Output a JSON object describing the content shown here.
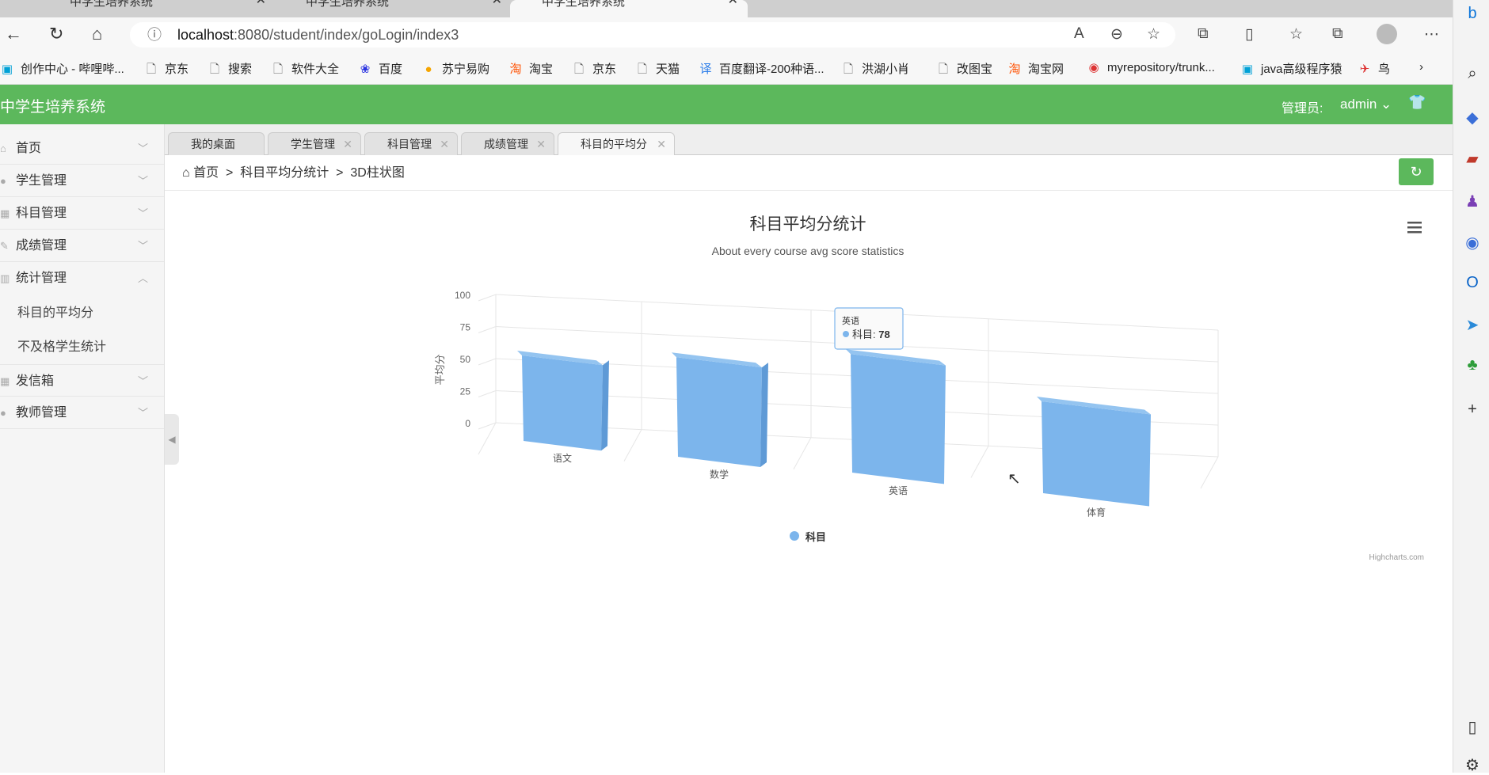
{
  "browser": {
    "tabs": [
      {
        "title": "中学生培养系统"
      },
      {
        "title": "中学生培养系统"
      },
      {
        "title": "中学生培养系统"
      }
    ],
    "url_host": "localhost",
    "url_path": ":8080/student/index/goLogin/index3",
    "bookmarks": [
      {
        "label": "创作中心 - 哔哩哔...",
        "icon": "bilibili-icon"
      },
      {
        "label": "京东",
        "icon": "page-icon"
      },
      {
        "label": "搜索",
        "icon": "page-icon"
      },
      {
        "label": "软件大全",
        "icon": "page-icon"
      },
      {
        "label": "百度",
        "icon": "baidu-icon"
      },
      {
        "label": "苏宁易购",
        "icon": "suning-icon"
      },
      {
        "label": "淘宝",
        "icon": "taobao-icon"
      },
      {
        "label": "京东",
        "icon": "page-icon"
      },
      {
        "label": "天猫",
        "icon": "page-icon"
      },
      {
        "label": "百度翻译-200种语...",
        "icon": "translate-icon"
      },
      {
        "label": "洪湖小肖",
        "icon": "page-icon"
      },
      {
        "label": "改图宝",
        "icon": "page-icon"
      },
      {
        "label": "淘宝网",
        "icon": "taobao-icon"
      },
      {
        "label": "myrepository/trunk...",
        "icon": "chrome-icon"
      },
      {
        "label": "java高级程序猿",
        "icon": "bilibili-icon"
      },
      {
        "label": "鸟",
        "icon": "bird-icon"
      }
    ]
  },
  "header": {
    "title": "中学生培养系统",
    "admin_label": "管理员:",
    "admin_name": "admin"
  },
  "sidebar": {
    "items": [
      {
        "label": "首页"
      },
      {
        "label": "学生管理"
      },
      {
        "label": "科目管理"
      },
      {
        "label": "成绩管理"
      },
      {
        "label": "统计管理"
      },
      {
        "label": "科目的平均分"
      },
      {
        "label": "不及格学生统计"
      },
      {
        "label": "发信箱"
      },
      {
        "label": "教师管理"
      }
    ]
  },
  "page_tabs": [
    {
      "label": "我的桌面"
    },
    {
      "label": "学生管理"
    },
    {
      "label": "科目管理"
    },
    {
      "label": "成绩管理"
    },
    {
      "label": "科目的平均分"
    }
  ],
  "breadcrumb": {
    "home": "首页",
    "sep": ">",
    "level1": "科目平均分统计",
    "level2": "3D柱状图"
  },
  "chart_data": {
    "type": "bar",
    "title": "科目平均分统计",
    "subtitle": "About every course avg score statistics",
    "ylabel": "平均分",
    "ylim": [
      0,
      100
    ],
    "yticks": [
      "0",
      "25",
      "50",
      "75",
      "100"
    ],
    "categories": [
      "语文",
      "数学",
      "英语",
      "体育"
    ],
    "series": [
      {
        "name": "科目",
        "values": [
          60,
          68,
          78,
          58
        ],
        "color": "#7cb5ec"
      }
    ],
    "three_d": true,
    "legend": "bottom-center",
    "tooltip": {
      "category": "英语",
      "series": "科目",
      "value": "78"
    },
    "credits": "Highcharts.com"
  }
}
